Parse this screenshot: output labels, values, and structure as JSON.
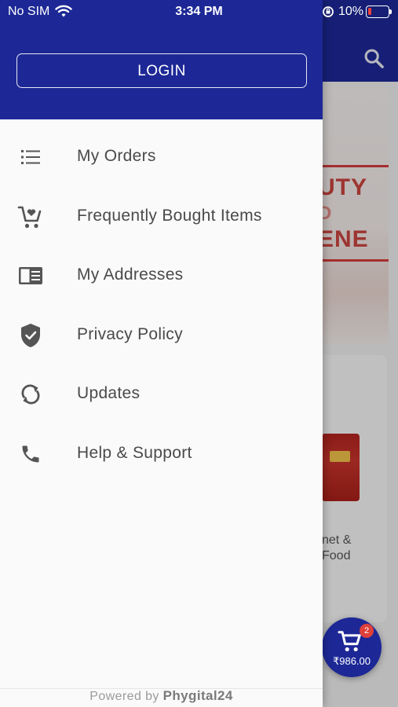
{
  "status_bar": {
    "carrier": "No SIM",
    "time": "3:34 PM",
    "battery": "10%"
  },
  "drawer": {
    "login_label": "LOGIN",
    "menu": [
      {
        "label": "My Orders",
        "icon": "list-icon"
      },
      {
        "label": "Frequently Bought Items",
        "icon": "cart-heart-icon"
      },
      {
        "label": "My Addresses",
        "icon": "address-card-icon"
      },
      {
        "label": "Privacy Policy",
        "icon": "shield-check-icon"
      },
      {
        "label": "Updates",
        "icon": "sync-icon"
      },
      {
        "label": "Help & Support",
        "icon": "phone-icon"
      }
    ],
    "footer": {
      "prefix": "Powered by",
      "brand": "Phygital24"
    }
  },
  "background": {
    "banner_line_1": "UTY",
    "banner_line_2": "D",
    "banner_line_3": "ENE",
    "product_name": "net &\nFood",
    "cart": {
      "count": "2",
      "total": "₹986.00"
    }
  },
  "colors": {
    "primary": "#1d2896",
    "drawer_bg": "#fafafa",
    "menu_text": "#4a4a4a",
    "icon": "#555555",
    "badge": "#e0403a"
  }
}
